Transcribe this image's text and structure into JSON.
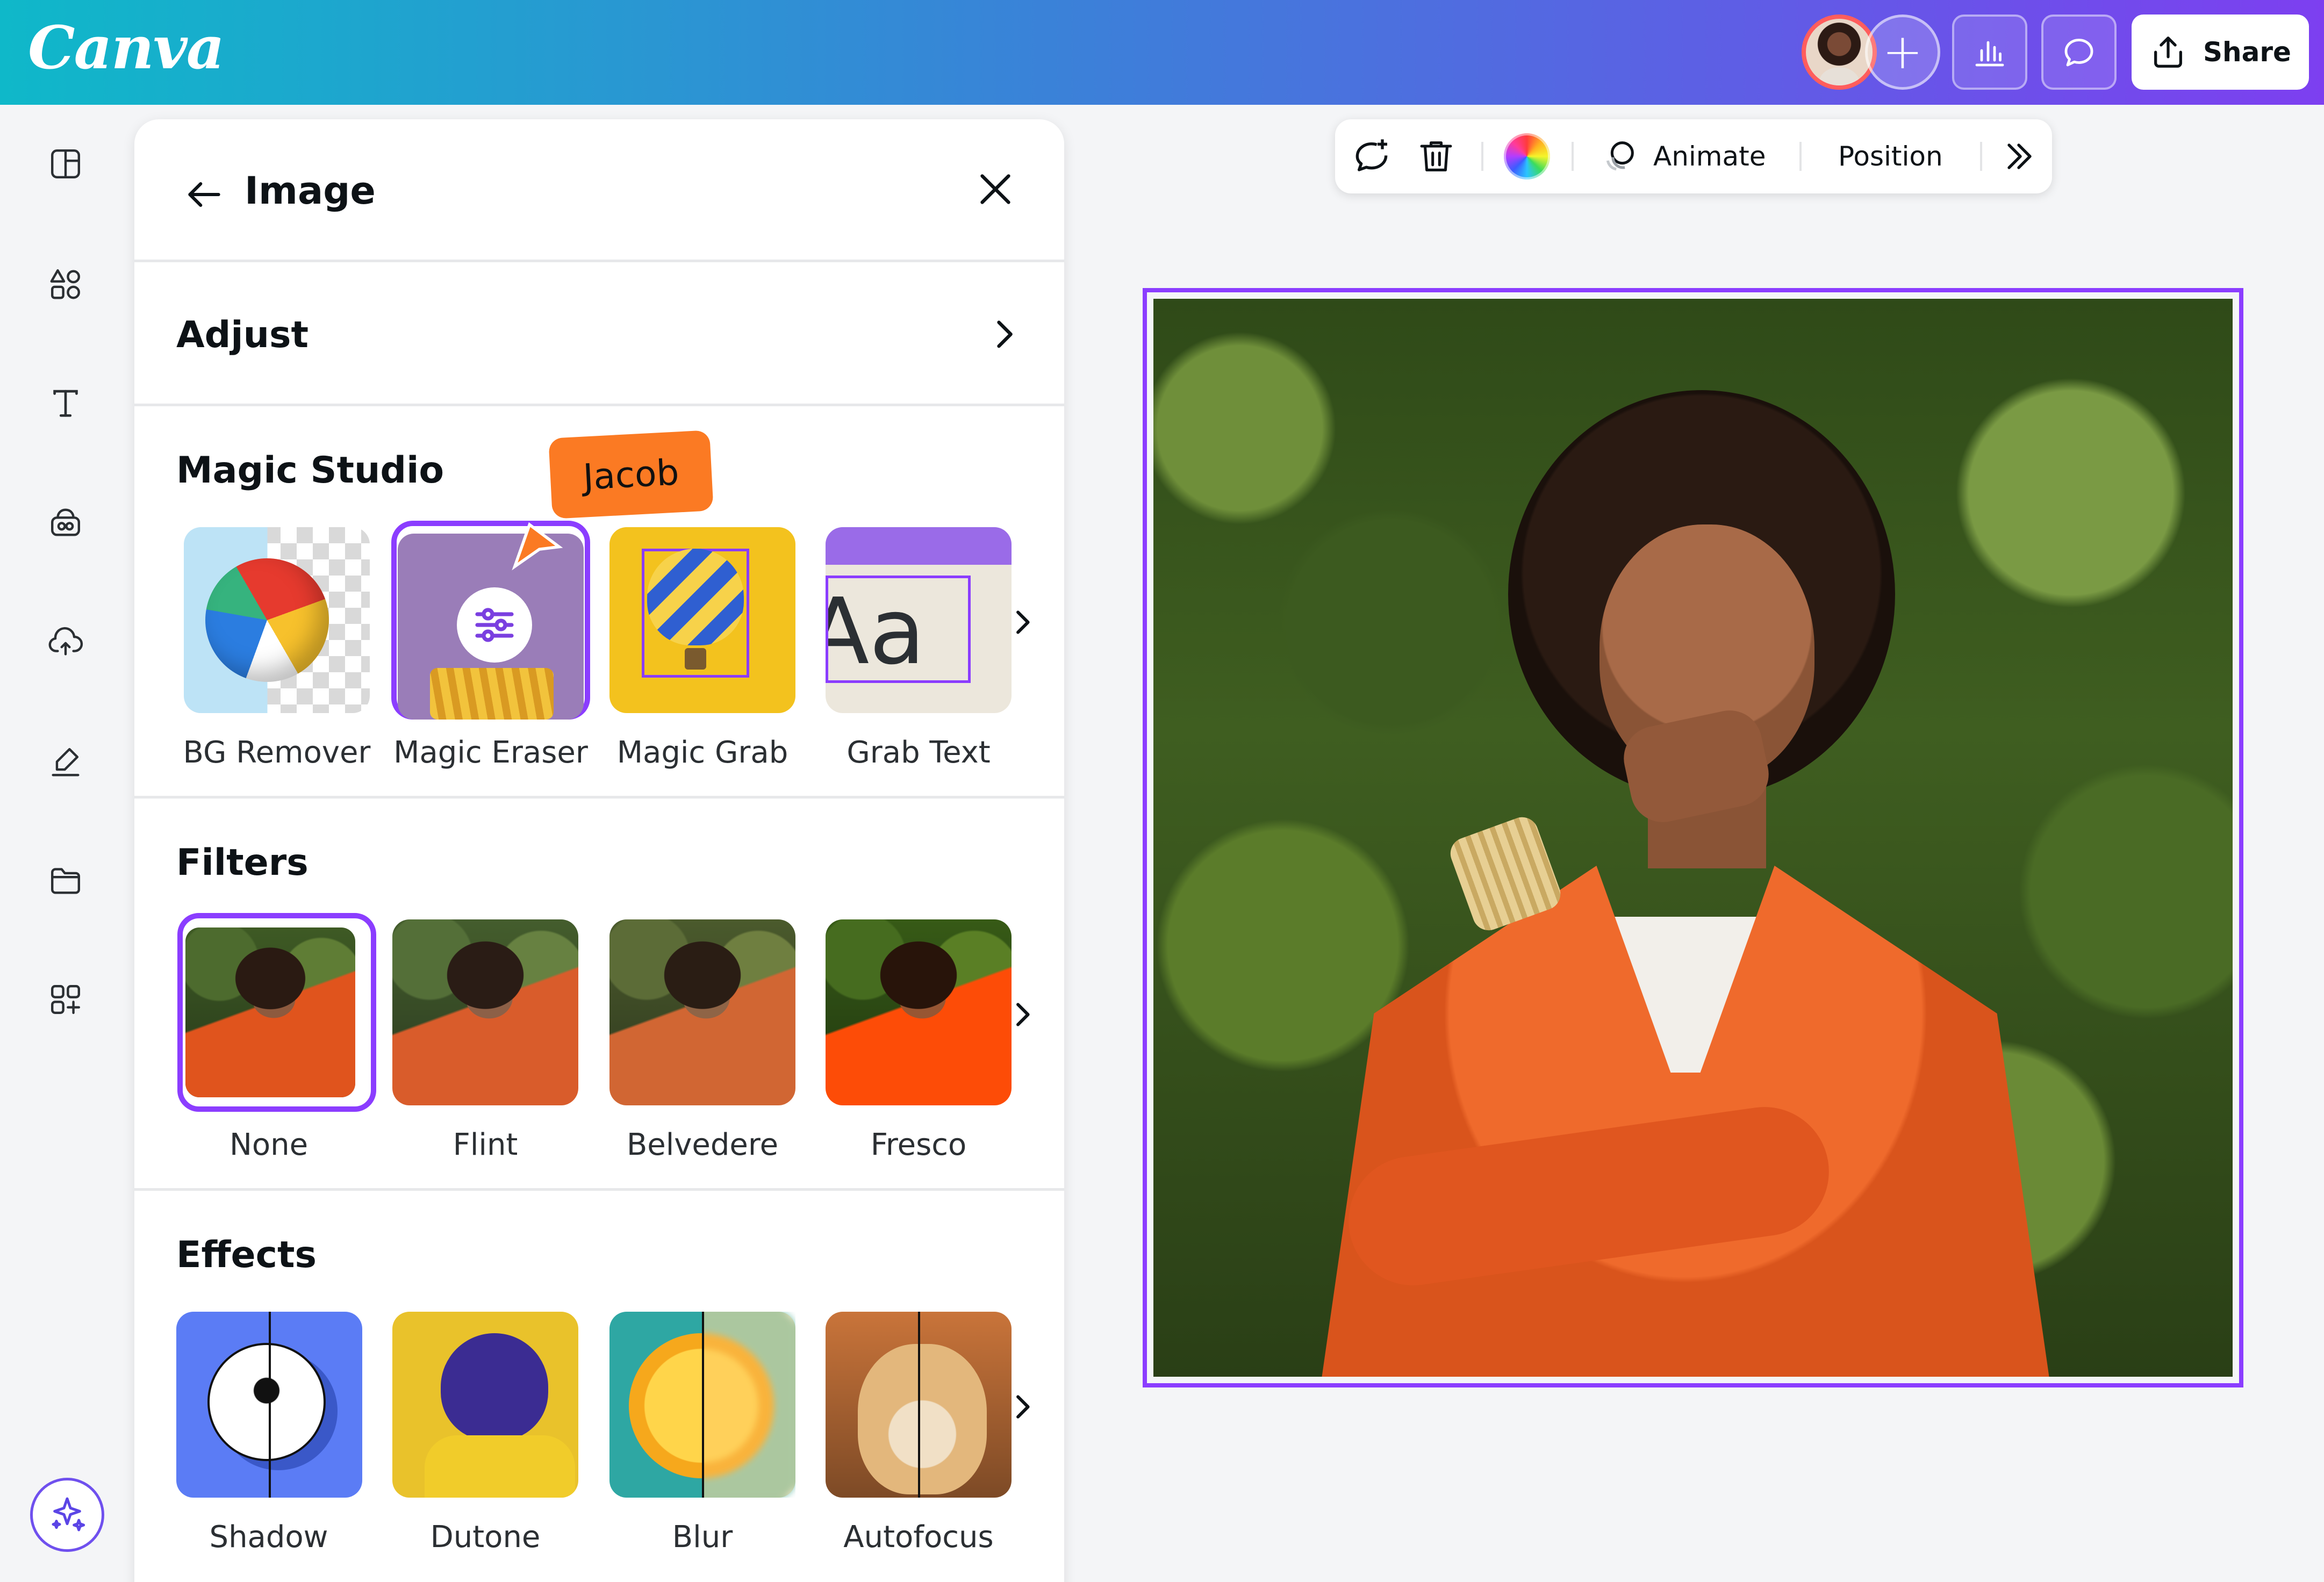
{
  "app": {
    "logo_text": "Canva",
    "share_label": "Share"
  },
  "panel": {
    "title": "Image",
    "adjust_label": "Adjust",
    "sections": [
      {
        "title": "Magic Studio",
        "items": [
          "BG Remover",
          "Magic Eraser",
          "Magic Grab",
          "Grab Text"
        ]
      },
      {
        "title": "Filters",
        "items": [
          "None",
          "Flint",
          "Belvedere",
          "Fresco"
        ],
        "selected": "None"
      },
      {
        "title": "Effects",
        "items": [
          "Shadow",
          "Dutone",
          "Blur",
          "Autofocus"
        ]
      }
    ]
  },
  "toolbar": {
    "animate_label": "Animate",
    "position_label": "Position"
  },
  "collaborator": {
    "name": "Jacob",
    "tag_color": "#fb7a23"
  },
  "colors": {
    "accent": "#8b3dff",
    "gradient_start": "#0fb8c9",
    "gradient_end": "#7d3ff0"
  },
  "icons": {
    "rail": [
      "design-icon",
      "elements-icon",
      "text-icon",
      "brand-icon",
      "uploads-icon",
      "draw-icon",
      "projects-icon",
      "apps-icon"
    ],
    "magic": "sparkle-icon"
  }
}
